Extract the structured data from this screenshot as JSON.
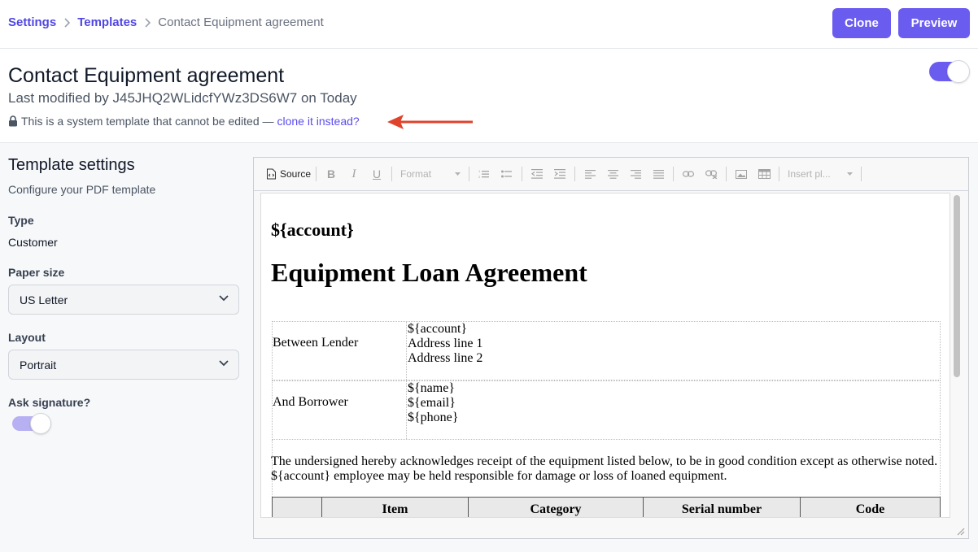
{
  "breadcrumb": {
    "settings": "Settings",
    "templates": "Templates",
    "current": "Contact Equipment agreement"
  },
  "actions": {
    "clone": "Clone",
    "preview": "Preview"
  },
  "header": {
    "title": "Contact Equipment agreement",
    "modified": "Last modified by J45JHQ2WLidcfYWz3DS6W7 on Today",
    "notice_text": "This is a system template that cannot be edited —",
    "notice_link": "clone it instead",
    "notice_end": "?",
    "enabled": true
  },
  "settings_panel": {
    "title": "Template settings",
    "subtitle": "Configure your PDF template",
    "type_label": "Type",
    "type_value": "Customer",
    "paper_label": "Paper size",
    "paper_value": "US Letter",
    "layout_label": "Layout",
    "layout_value": "Portrait",
    "signature_label": "Ask signature?",
    "signature_enabled": true
  },
  "toolbar": {
    "source": "Source",
    "bold": "B",
    "italic": "I",
    "underline": "U",
    "format": "Format",
    "insert_placeholder": "Insert pl..."
  },
  "document": {
    "heading_account": "${account}",
    "heading_title": "Equipment Loan Agreement",
    "lender_label": "Between Lender",
    "lender_lines": [
      "${account}",
      "Address line 1",
      "Address line 2"
    ],
    "borrower_label": "And Borrower",
    "borrower_lines": [
      "${name}",
      "${email}",
      "${phone}"
    ],
    "ack_line1": "The undersigned hereby acknowledges receipt of the equipment listed below, to be in good condition except as otherwise noted.",
    "ack_line2": "${account} employee may be held responsible for damage or loss of loaned equipment.",
    "table_headers": [
      "",
      "Item",
      "Category",
      "Serial number",
      "Code"
    ]
  },
  "colors": {
    "accent": "#6b5cf0",
    "link": "#4f46e5",
    "arrow": "#e0432b"
  },
  "icons": [
    "chevron-right-icon",
    "lock-icon",
    "arrow-left-icon",
    "chevron-down-icon",
    "source-icon",
    "bold-icon",
    "italic-icon",
    "underline-icon",
    "numbered-list-icon",
    "bulleted-list-icon",
    "outdent-icon",
    "indent-icon",
    "align-left-icon",
    "align-center-icon",
    "align-right-icon",
    "justify-icon",
    "link-icon",
    "unlink-icon",
    "image-icon",
    "table-icon",
    "resize-handle-icon"
  ]
}
